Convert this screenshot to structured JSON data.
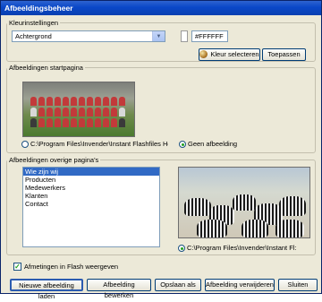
{
  "window": {
    "title": "Afbeeldingsbeheer"
  },
  "kleur": {
    "legend": "Kleurinstellingen",
    "selected": "Achtergrond",
    "hex": "#FFFFFF",
    "swatch_color": "#FFFFFF",
    "select_button": "Kleur selecteren",
    "apply_button": "Toepassen"
  },
  "startpagina": {
    "legend": "Afbeeldingen startpagina",
    "path_option": "C:\\Program Files\\Invender\\Instant Flashfiles Hom",
    "none_option": "Geen afbeelding"
  },
  "overige": {
    "legend": "Afbeeldingen overige pagina's",
    "pages": [
      "Wie zijn wij",
      "Producten",
      "Medewerkers",
      "Klanten",
      "Contact"
    ],
    "selected_index": 0,
    "path_option": "C:\\Program Files\\Invender\\Instant Fl:"
  },
  "flash_checkbox": {
    "label": "Afmetingen in Flash weergeven",
    "checked": true
  },
  "bottom_buttons": {
    "new": "Nieuwe afbeelding laden",
    "edit": "Afbeelding bewerken",
    "save_as": "Opslaan als",
    "delete": "Afbeelding verwijderen",
    "close": "Sluiten"
  }
}
